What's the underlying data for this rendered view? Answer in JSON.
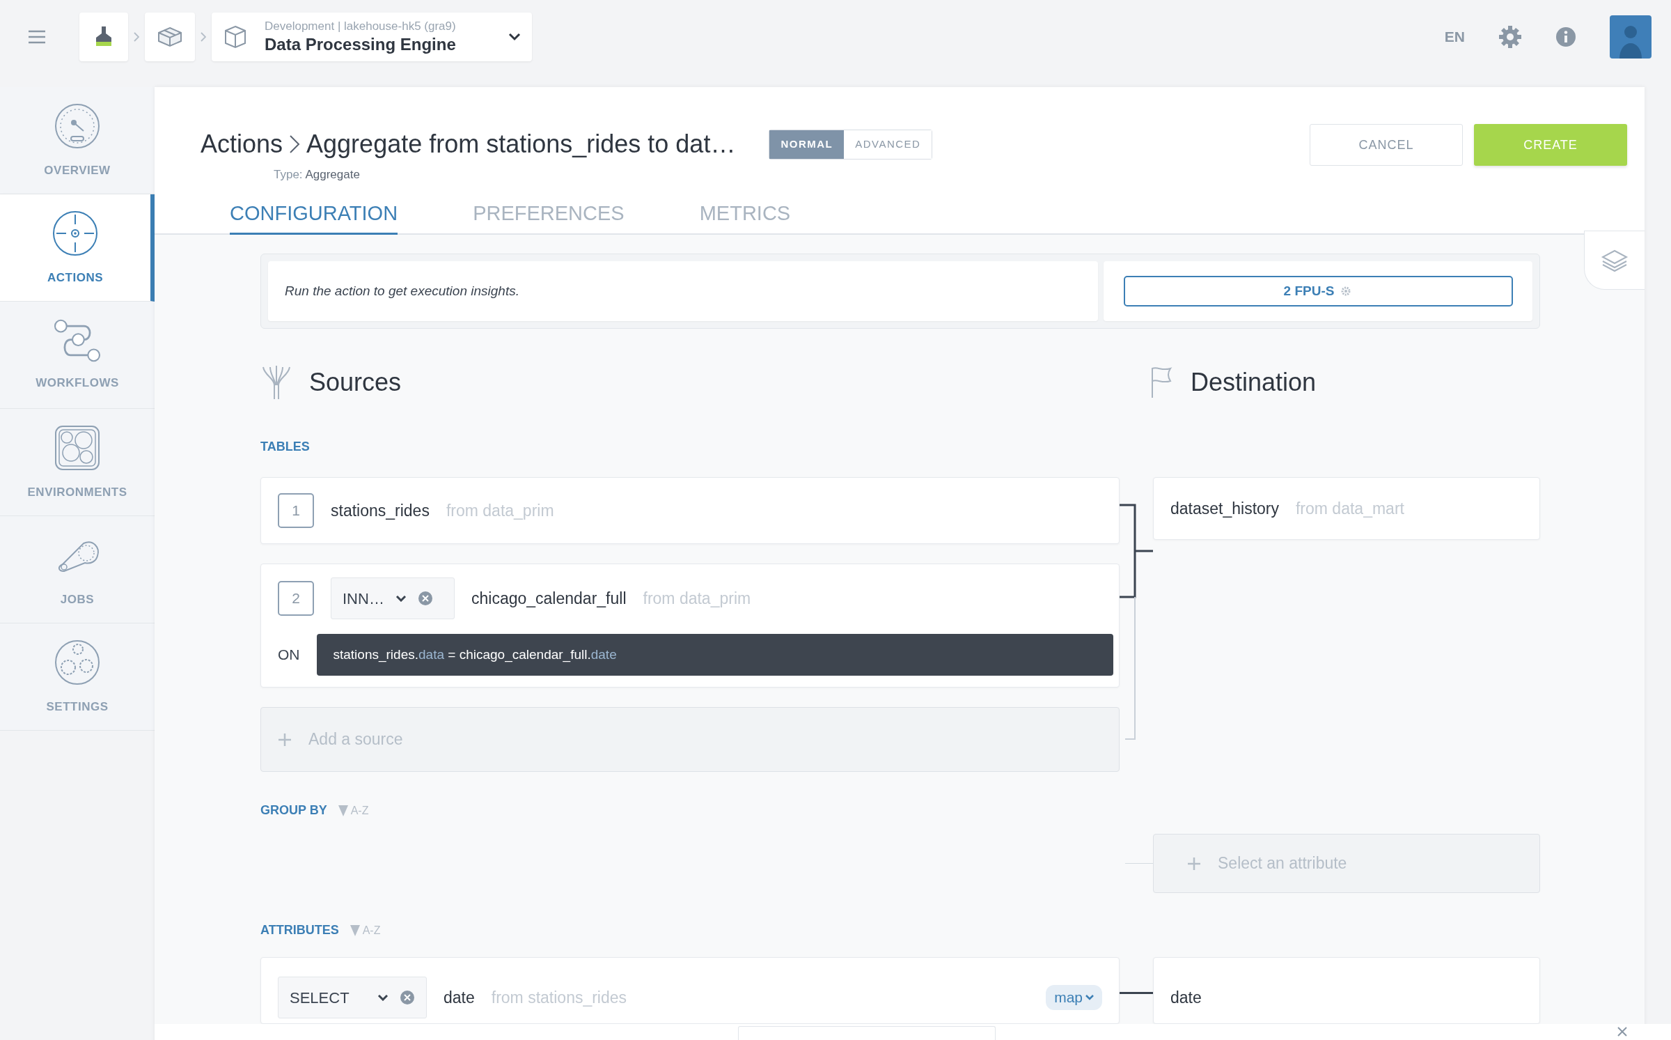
{
  "top_bar": {
    "breadcrumb": {
      "context": "Development | lakehouse-hk5 (gra9)",
      "title": "Data Processing Engine"
    },
    "language": "EN"
  },
  "sidebar": {
    "items": [
      {
        "label": "OVERVIEW",
        "kind": "overview",
        "selected": false
      },
      {
        "label": "ACTIONS",
        "kind": "actions",
        "selected": true
      },
      {
        "label": "WORKFLOWS",
        "kind": "workflows",
        "selected": false
      },
      {
        "label": "ENVIRONMENTS",
        "kind": "environments",
        "selected": false
      },
      {
        "label": "JOBS",
        "kind": "jobs",
        "selected": false
      },
      {
        "label": "SETTINGS",
        "kind": "settings",
        "selected": false
      }
    ]
  },
  "header": {
    "section": "Actions",
    "title": "Aggregate from stations_rides to dat…",
    "type_label": "Type:",
    "type_value": "Aggregate",
    "modes": [
      {
        "label": "NORMAL",
        "selected": true
      },
      {
        "label": "ADVANCED",
        "selected": false
      }
    ],
    "buttons": [
      {
        "label": "CANCEL",
        "kind": "secondary"
      },
      {
        "label": "CREATE",
        "kind": "primary"
      }
    ]
  },
  "tabs": [
    {
      "label": "CONFIGURATION",
      "selected": true
    },
    {
      "label": "PREFERENCES",
      "selected": false
    },
    {
      "label": "METRICS",
      "selected": false
    }
  ],
  "insights": {
    "message": "Run the action to get execution insights.",
    "fpu": "2 FPU-S"
  },
  "sources": {
    "title": "Sources",
    "tables_label": "TABLES",
    "tables": [
      {
        "number": "1",
        "name": "stations_rides",
        "from": "from data_prim"
      },
      {
        "number": "2",
        "join": "INN…",
        "name": "chicago_calendar_full",
        "from": "from data_prim",
        "on_label": "ON",
        "condition": [
          {
            "text": "stations_rides.",
            "kind": "table"
          },
          {
            "text": "data",
            "kind": "field"
          },
          {
            "text": " = ",
            "kind": "table"
          },
          {
            "text": "chicago_calendar_full.",
            "kind": "table"
          },
          {
            "text": "date",
            "kind": "field"
          }
        ]
      }
    ],
    "add_label": "Add a source"
  },
  "destination": {
    "title": "Destination",
    "table": {
      "name": "dataset_history",
      "from": "from data_mart"
    }
  },
  "group_by": {
    "label": "GROUP BY",
    "sort": "A-Z",
    "placeholder": "Select an attribute"
  },
  "attributes": {
    "label": "ATTRIBUTES",
    "sort": "A-Z",
    "rows": [
      {
        "function": "SELECT",
        "name": "date",
        "from": "from stations_rides",
        "mapping": "map",
        "destination": "date"
      }
    ]
  }
}
